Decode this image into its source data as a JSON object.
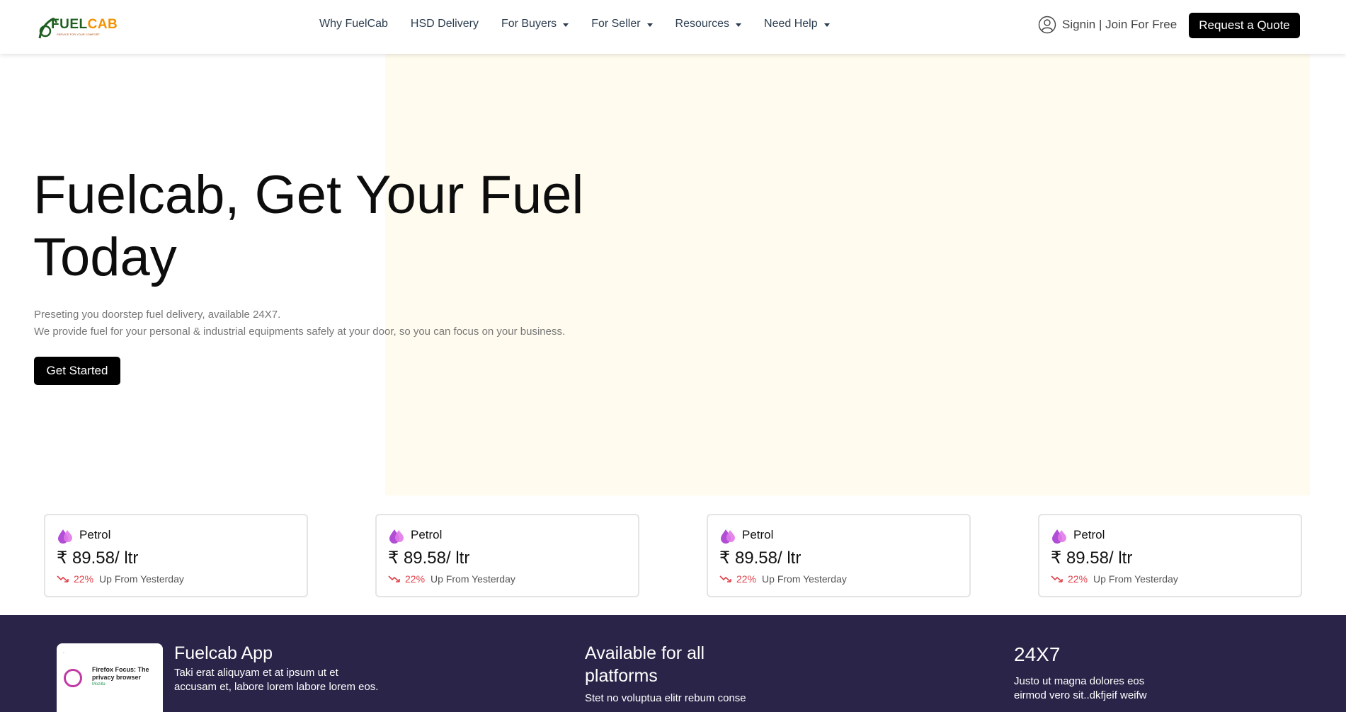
{
  "brand": {
    "logo_text_dark": "FUEL",
    "logo_text_accent": "CAB",
    "tagline": "SERVICE FOR YOUR COMFORT",
    "colors": {
      "green": "#2e7d32",
      "orange": "#f39200",
      "purple_dark": "#2a2448",
      "hero_bg": "#fffbee"
    }
  },
  "nav": {
    "items": [
      {
        "label": "Why FuelCab",
        "dropdown": false
      },
      {
        "label": "HSD Delivery",
        "dropdown": false
      },
      {
        "label": "For Buyers",
        "dropdown": true
      },
      {
        "label": "For Seller",
        "dropdown": true
      },
      {
        "label": "Resources",
        "dropdown": true
      },
      {
        "label": "Need Help",
        "dropdown": true
      }
    ],
    "signin_label": "Signin | Join For Free",
    "signin_icon": "user-circle-icon",
    "quote_label": "Request a Quote"
  },
  "hero": {
    "title_line1": "Fuelcab, Get Your Fuel",
    "title_line2": "Today",
    "subtitle_line1": "Preseting you doorstep fuel delivery, available 24X7.",
    "subtitle_line2": "We provide fuel for your personal & industrial equipments safely at your door, so you can focus on your business.",
    "cta_label": "Get Started"
  },
  "price_cards": [
    {
      "fuel": "Petrol",
      "price": "₹ 89.58/ ltr",
      "change": "22%",
      "change_text": "Up From Yesterday",
      "icon": "fuel-drop-icon",
      "trend_icon": "trend-down-icon"
    },
    {
      "fuel": "Petrol",
      "price": "₹ 89.58/ ltr",
      "change": "22%",
      "change_text": "Up From Yesterday",
      "icon": "fuel-drop-icon",
      "trend_icon": "trend-down-icon"
    },
    {
      "fuel": "Petrol",
      "price": "₹ 89.58/ ltr",
      "change": "22%",
      "change_text": "Up From Yesterday",
      "icon": "fuel-drop-icon",
      "trend_icon": "trend-down-icon"
    },
    {
      "fuel": "Petrol",
      "price": "₹ 89.58/ ltr",
      "change": "22%",
      "change_text": "Up From Yesterday",
      "icon": "fuel-drop-icon",
      "trend_icon": "trend-down-icon"
    }
  ],
  "band": {
    "app": {
      "title": "Fuelcab App",
      "text": "Taki erat aliquyam et at ipsum ut et accusam et, labore lorem labore lorem eos.",
      "phone_app_title": "Firefox Focus: The privacy browser",
      "phone_app_sub": "Mozilla"
    },
    "platforms": {
      "title": "Available for all platforms",
      "text": "Stet no voluptua elitr rebum conse"
    },
    "always": {
      "title": "24X7",
      "text": "Justo ut magna dolores eos eirmod vero sit..dkfjeif weifw"
    }
  }
}
